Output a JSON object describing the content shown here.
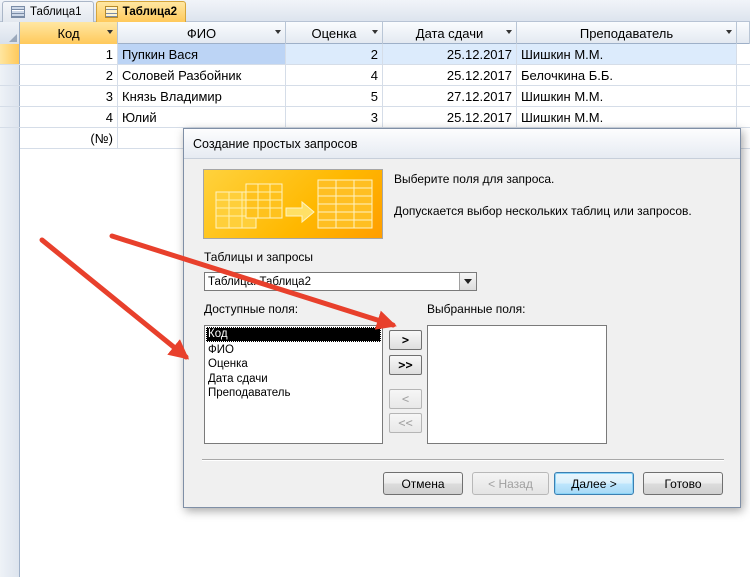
{
  "tabs": [
    {
      "label": "Таблица1",
      "active": false
    },
    {
      "label": "Таблица2",
      "active": true
    }
  ],
  "table": {
    "columns": [
      "Код",
      "ФИО",
      "Оценка",
      "Дата сдачи",
      "Преподаватель"
    ],
    "rows": [
      [
        "1",
        "Пупкин Вася",
        "2",
        "25.12.2017",
        "Шишкин М.М."
      ],
      [
        "2",
        "Соловей Разбойник",
        "4",
        "25.12.2017",
        "Белочкина Б.Б."
      ],
      [
        "3",
        "Князь Владимир",
        "5",
        "27.12.2017",
        "Шишкин М.М."
      ],
      [
        "4",
        "Юлий",
        "3",
        "25.12.2017",
        "Шишкин М.М."
      ]
    ],
    "new_row_marker": "*",
    "new_row_placeholder": "(№)"
  },
  "dialog": {
    "title": "Создание простых запросов",
    "intro_line1": "Выберите поля для запроса.",
    "intro_line2": "Допускается выбор нескольких таблиц или запросов.",
    "tables_label": "Таблицы и запросы",
    "tables_value": "Таблица: Таблица2",
    "available_label": "Доступные поля:",
    "selected_label": "Выбранные поля:",
    "available_fields": [
      "Код",
      "ФИО",
      "Оценка",
      "Дата сдачи",
      "Преподаватель"
    ],
    "selected_fields": [],
    "move_one": ">",
    "move_all": ">>",
    "remove_one": "<",
    "remove_all": "<<",
    "cancel": "Отмена",
    "back": "< Назад",
    "next": "Далее >",
    "finish": "Готово"
  },
  "colors": {
    "annotation_arrow": "#e8402c",
    "active_tab": "#ffc95b",
    "current_row": "#dcebfc"
  }
}
